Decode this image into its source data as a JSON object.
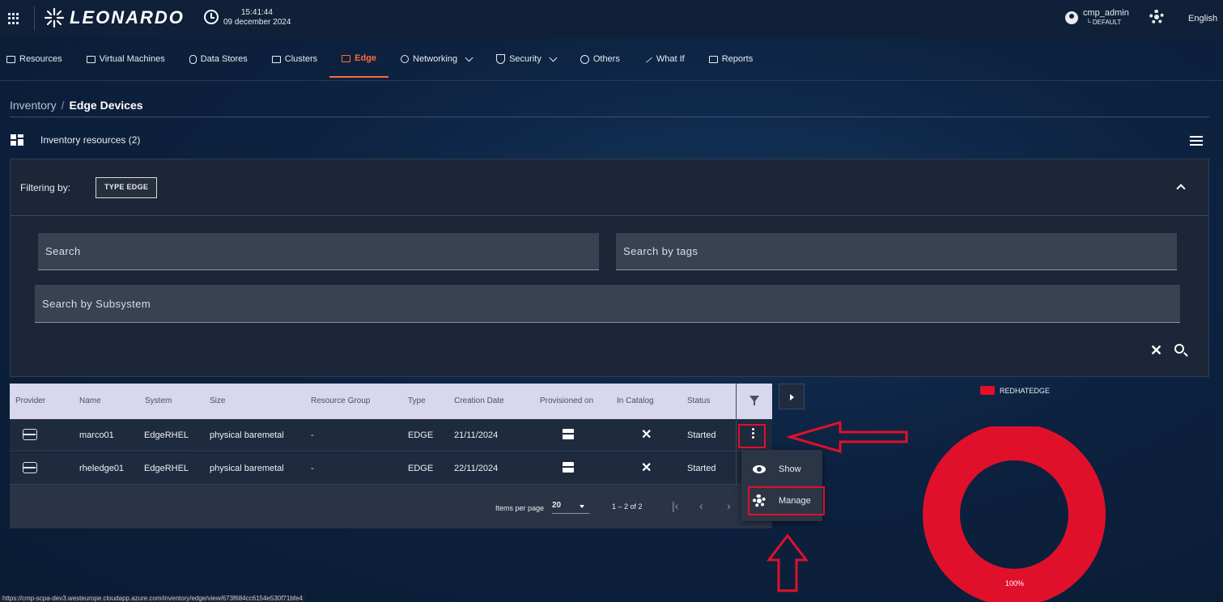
{
  "header": {
    "brand": "LEONARDO",
    "time": "15:41:44",
    "date": "09 december 2024",
    "username": "cmp_admin",
    "tenant": "└ DEFAULT",
    "language": "English"
  },
  "nav": {
    "items": [
      {
        "label": "Resources",
        "icon": "resources-icon"
      },
      {
        "label": "Virtual Machines",
        "icon": "monitor-icon"
      },
      {
        "label": "Data Stores",
        "icon": "database-icon"
      },
      {
        "label": "Clusters",
        "icon": "cluster-icon"
      },
      {
        "label": "Edge",
        "icon": "edge-icon",
        "active": true
      },
      {
        "label": "Networking",
        "icon": "antenna-icon",
        "dropdown": true
      },
      {
        "label": "Security",
        "icon": "shield-icon",
        "dropdown": true
      },
      {
        "label": "Others",
        "icon": "globe-icon"
      },
      {
        "label": "What If",
        "icon": "path-icon"
      },
      {
        "label": "Reports",
        "icon": "report-icon"
      }
    ],
    "active_color": "#ff6a3d"
  },
  "breadcrumb": {
    "parent": "Inventory",
    "separator": "/",
    "current": "Edge Devices"
  },
  "inventory": {
    "title": "Inventory resources (2)"
  },
  "filter": {
    "label": "Filtering by:",
    "chip": "TYPE  EDGE",
    "search_placeholder": "Search",
    "tags_placeholder": "Search by tags",
    "subsystem_placeholder": "Search by Subsystem"
  },
  "table": {
    "columns": [
      "Provider",
      "Name",
      "System",
      "Size",
      "Resource Group",
      "Type",
      "Creation Date",
      "Provisioned on",
      "In Catalog",
      "Status"
    ],
    "rows": [
      {
        "provider_icon": "server-icon",
        "name": "marco01",
        "system": "EdgeRHEL",
        "size": "physical baremetal",
        "resource_group": "-",
        "type": "EDGE",
        "creation_date": "21/11/2024",
        "provisioned_icon": "server-icon",
        "in_catalog": "✕",
        "status": "Started"
      },
      {
        "provider_icon": "server-icon",
        "name": "rheledge01",
        "system": "EdgeRHEL",
        "size": "physical baremetal",
        "resource_group": "-",
        "type": "EDGE",
        "creation_date": "22/11/2024",
        "provisioned_icon": "server-icon",
        "in_catalog": "✕",
        "status": "Started"
      }
    ]
  },
  "pager": {
    "items_label": "Items per page",
    "page_size": "20",
    "range": "1 – 2 of 2"
  },
  "context_menu": {
    "items": [
      {
        "label": "Show",
        "icon": "eye-icon"
      },
      {
        "label": "Manage",
        "icon": "gear-icon"
      }
    ]
  },
  "chart_data": {
    "type": "pie",
    "categories": [
      "REDHATEDGE"
    ],
    "values": [
      100
    ],
    "value_labels": [
      "100%"
    ],
    "colors": [
      "#e0102b"
    ],
    "legend": "top"
  },
  "status_bar": {
    "url": "https://cmp-scpa-dev3.westeurope.cloudapp.azure.com/inventory/edge/view/673f684cc6154e530f71bfe4"
  },
  "annotation_color": "#e0102b"
}
